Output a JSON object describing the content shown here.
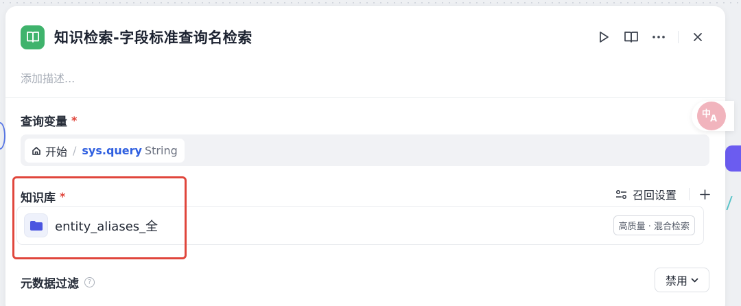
{
  "node": {
    "title": "知识检索-字段标准查询名检索",
    "description_placeholder": "添加描述..."
  },
  "header_actions": {
    "run": "play-icon",
    "docs": "book-open-icon",
    "more": "more-icon",
    "close": "close-icon"
  },
  "query_variable": {
    "label": "查询变量",
    "required_mark": "*",
    "source_node": "开始",
    "separator": "/",
    "variable": "sys.query",
    "type": "String"
  },
  "knowledge_base": {
    "label": "知识库",
    "required_mark": "*",
    "recall_settings_label": "召回设置",
    "add_icon": "plus-icon",
    "items": [
      {
        "name": "entity_aliases_全",
        "badge": "高质量 · 混合检索",
        "icon": "folder-icon"
      }
    ]
  },
  "metadata_filter": {
    "label": "元数据过滤",
    "help_icon": "question-icon",
    "help_glyph": "?",
    "value": "禁用"
  },
  "translate_widget": {
    "glyph_top": "中",
    "glyph_bottom": "A"
  },
  "colors": {
    "app_icon_bg": "#3fb36c",
    "variable_accent": "#2f5fe0",
    "required": "#e0443a",
    "highlight": "#e0463c",
    "folder": "#4a55e0"
  }
}
